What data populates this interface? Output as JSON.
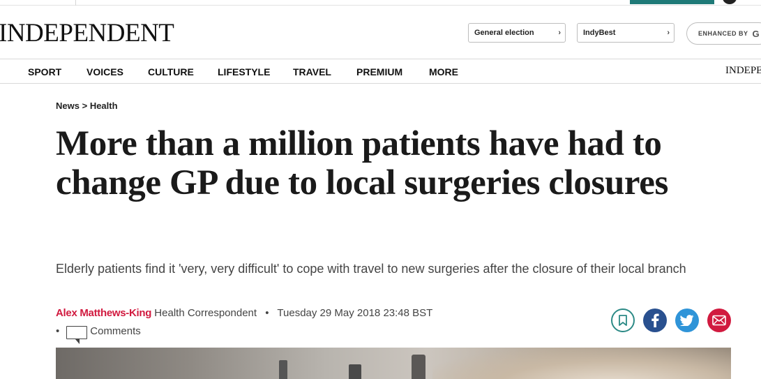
{
  "masthead": {
    "logo": "INDEPENDENT",
    "election_label": "General election",
    "indybest_label": "IndyBest",
    "search_label": "ENHANCED BY",
    "search_glyph": "G"
  },
  "nav": {
    "items": [
      "SPORT",
      "VOICES",
      "CULTURE",
      "LIFESTYLE",
      "TRAVEL",
      "PREMIUM",
      "MORE"
    ],
    "brand": "INDEPENDENT"
  },
  "breadcrumb": {
    "section": "News",
    "separator": ">",
    "subsection": "Health"
  },
  "article": {
    "headline": "More than a million patients have had to change GP due to local surgeries closures",
    "standfirst": "Elderly patients find it 'very, very difficult' to cope with travel to new surgeries after the closure of their local branch",
    "author": "Alex Matthews-King",
    "role": "Health Correspondent",
    "bullet": "•",
    "date": "Tuesday 29 May 2018 23:48 BST",
    "comments_label": "Comments"
  },
  "share": {
    "icons": [
      "bookmark-icon",
      "facebook-icon",
      "twitter-icon",
      "email-icon"
    ]
  },
  "colors": {
    "accent_red": "#d11a3f",
    "teal": "#1f7a78",
    "facebook": "#29508f",
    "twitter": "#2f94d8"
  }
}
